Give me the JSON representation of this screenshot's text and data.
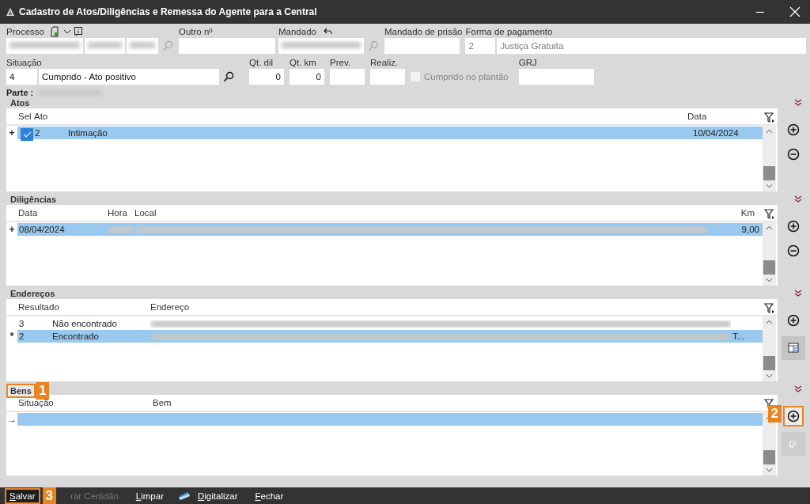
{
  "window": {
    "title": "Cadastro de Atos/Diligências e Remessa do Agente para a Central"
  },
  "processo": {
    "label": "Processo"
  },
  "outro_numero": {
    "label": "Outro nº"
  },
  "mandado": {
    "label": "Mandado"
  },
  "mandado_prisao": {
    "label": "Mandado de prisão"
  },
  "forma_pagamento": {
    "label": "Forma de pagamento",
    "code": "2",
    "value": "Justiça Gratuita",
    "readonly": true
  },
  "situacao": {
    "label": "Situação",
    "code": "4",
    "value": "Cumprido - Ato positivo"
  },
  "qt_dil": {
    "label": "Qt. dil",
    "value": "0"
  },
  "qt_km": {
    "label": "Qt. km",
    "value": "0"
  },
  "prev": {
    "label": "Prev."
  },
  "realiz": {
    "label": "Realiz."
  },
  "cumprido_plantao": {
    "label": "Cumprido no plantão",
    "checked": false,
    "disabled": true
  },
  "grj": {
    "label": "GRJ"
  },
  "parte": {
    "label": "Parte :"
  },
  "sections": [
    {
      "title": "Atos",
      "columns": [
        {
          "label": "Sel",
          "kind": "check"
        },
        {
          "label": "Ato",
          "kind": "text"
        },
        {
          "kind": "text"
        },
        {
          "label": "Data",
          "kind": "text"
        }
      ],
      "rows": [
        {
          "marker": "+",
          "selected": true,
          "cells": [
            {
              "checked": true
            },
            {
              "text": "2"
            },
            {
              "text": "Intimação"
            },
            {
              "text": "10/04/2024"
            }
          ]
        }
      ],
      "buttons": [
        {
          "kind": "add",
          "disabled": false
        },
        {
          "kind": "remove",
          "disabled": false
        }
      ]
    },
    {
      "title": "Diligências",
      "columns": [
        {
          "label": "Data",
          "kind": "text"
        },
        {
          "label": "Hora",
          "kind": "text"
        },
        {
          "label": "Local",
          "kind": "text"
        },
        {
          "label": "Km",
          "kind": "number"
        }
      ],
      "rows": [
        {
          "marker": "+",
          "selected": true,
          "cells": [
            {
              "text": "08/04/2024"
            },
            {
              "kind": "blurred"
            },
            {
              "kind": "blurred"
            },
            {
              "text": "9,00"
            }
          ]
        }
      ],
      "buttons": [
        {
          "kind": "add",
          "disabled": false
        },
        {
          "kind": "remove",
          "disabled": false
        }
      ]
    },
    {
      "title": "Endereços",
      "columns": [
        {
          "label": "Resultado",
          "kind": "text"
        },
        {
          "kind": "text"
        },
        {
          "label": "Endereço",
          "kind": "text"
        },
        {
          "kind": "text"
        }
      ],
      "rows": [
        {
          "selected": false,
          "cells": [
            {
              "text": "3"
            },
            {
              "text": "Não encontrado"
            },
            {
              "kind": "blurred"
            }
          ]
        },
        {
          "marker": "*",
          "selected": true,
          "cells": [
            {
              "text": "2"
            },
            {
              "text": "Encontrado"
            },
            {
              "kind": "blurred"
            },
            {
              "text": "T..."
            }
          ]
        }
      ],
      "buttons": [
        {
          "kind": "add",
          "disabled": false
        },
        {
          "kind": "table",
          "disabled": false
        }
      ]
    },
    {
      "title": "Bens",
      "callout": "1",
      "columns": [
        {
          "label": "Situação",
          "kind": "text"
        },
        {
          "label": "Bem",
          "kind": "text"
        }
      ],
      "rows": [
        {
          "marker": "→",
          "selected": true
        }
      ],
      "buttons": [
        {
          "kind": "add",
          "disabled": false,
          "callout": "2"
        },
        {
          "kind": "layout",
          "disabled": true
        }
      ]
    }
  ],
  "toolbar": [
    {
      "kind": "plain",
      "label": "Salvar",
      "underline_first": true,
      "disabled": false,
      "callout": "3"
    },
    {
      "kind": "plain",
      "label": "rar Certidão",
      "underline_first": false,
      "disabled": true
    },
    {
      "kind": "plain",
      "label": "Limpar",
      "underline_first": true,
      "disabled": false
    },
    {
      "kind": "scan",
      "label": "Digitalizar",
      "underline_first": true,
      "disabled": false
    },
    {
      "kind": "plain",
      "label": "Fechar",
      "underline_first": true,
      "disabled": false
    }
  ]
}
